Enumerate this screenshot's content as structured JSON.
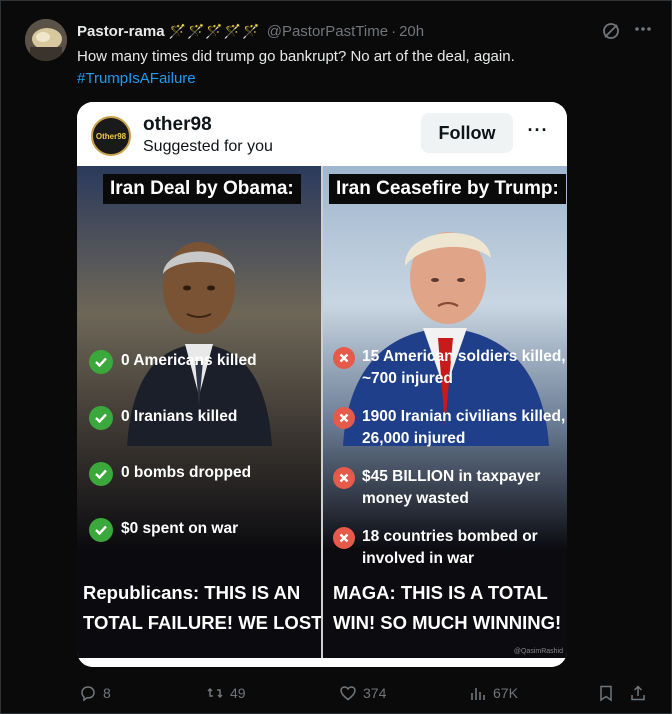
{
  "tweet": {
    "author_name": "Pastor-rama",
    "name_decoration": "🪄🪄🪄🪄🪄",
    "handle": "@PastorPastTime",
    "separator": "·",
    "time": "20h",
    "text": "How many times did trump go bankrupt? No art of the deal, again.",
    "hashtag": "#TrumpIsAFailure"
  },
  "embedded": {
    "account_name": "other98",
    "avatar_text": "Other98",
    "subtitle": "Suggested for you",
    "follow_label": "Follow",
    "more_label": "···",
    "left": {
      "title": "Iran Deal by Obama:",
      "items": [
        "0 Americans killed",
        "0 Iranians killed",
        "0 bombs dropped",
        "$0 spent on war"
      ],
      "footer_line1": "Republicans: THIS IS AN",
      "footer_line2": "TOTAL FAILURE! WE LOST!"
    },
    "right": {
      "title": "Iran Ceasefire by Trump:",
      "items": [
        {
          "line1": "15 American soldiers killed,",
          "line2": "~700 injured"
        },
        {
          "line1": "1900 Iranian civilians killed,",
          "line2": "26,000 injured"
        },
        {
          "line1": "$45 BILLION in taxpayer",
          "line2": "money wasted"
        },
        {
          "line1": "18 countries bombed or",
          "line2": "involved in war"
        }
      ],
      "footer_line1": "MAGA: THIS IS A TOTAL",
      "footer_line2": "WIN! SO MUCH WINNING!"
    },
    "credit": "@QasimRashid"
  },
  "actions": {
    "replies": "8",
    "reposts": "49",
    "likes": "374",
    "views": "67K"
  },
  "colors": {
    "link": "#1d9bf0",
    "muted": "#71767b",
    "check_green": "#3aa83a",
    "cross_red": "#e55a4b"
  }
}
